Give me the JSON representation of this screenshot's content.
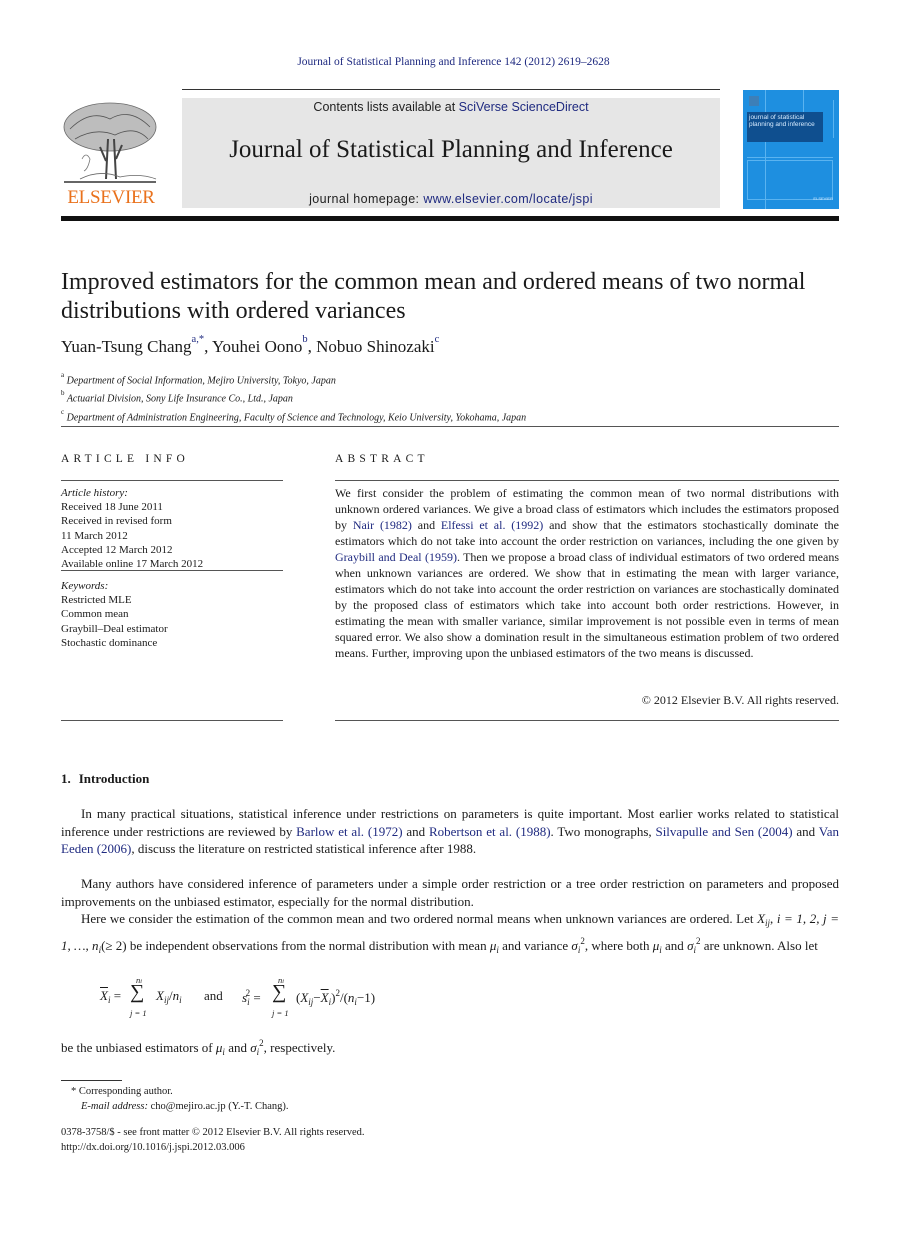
{
  "running_header": "Journal of Statistical Planning and Inference 142 (2012) 2619–2628",
  "masthead": {
    "publisher_logo_text": "ELSEVIER",
    "contents_prefix": "Contents lists available at ",
    "contents_link": "SciVerse ScienceDirect",
    "journal_title": "Journal of Statistical Planning and Inference",
    "homepage_prefix": "journal homepage: ",
    "homepage_link": "www.elsevier.com/locate/jspi",
    "cover_title": "journal of statistical planning and inference",
    "colors": {
      "publisher_orange": "#e9711c",
      "link_blue": "#1f2a80",
      "cover_blue": "#1e8fe0",
      "masthead_gray": "#e6e6e6"
    }
  },
  "article": {
    "title": "Improved estimators for the common mean and ordered means of two normal distributions with ordered variances",
    "authors": [
      {
        "name": "Yuan-Tsung Chang",
        "marks": "a,*",
        "separator": ", "
      },
      {
        "name": "Youhei Oono",
        "marks": "b",
        "separator": ", "
      },
      {
        "name": "Nobuo Shinozaki",
        "marks": "c",
        "separator": ""
      }
    ],
    "affiliations": [
      {
        "mark": "a",
        "text": "Department of Social Information, Mejiro University, Tokyo, Japan"
      },
      {
        "mark": "b",
        "text": "Actuarial Division, Sony Life Insurance Co., Ltd., Japan"
      },
      {
        "mark": "c",
        "text": "Department of Administration Engineering, Faculty of Science and Technology, Keio University, Yokohama, Japan"
      }
    ]
  },
  "article_info": {
    "heading": "ARTICLE INFO",
    "history_label": "Article history:",
    "history": [
      "Received 18 June 2011",
      "Received in revised form",
      "11 March 2012",
      "Accepted 12 March 2012",
      "Available online 17 March 2012"
    ],
    "keywords_label": "Keywords:",
    "keywords": [
      "Restricted MLE",
      "Common mean",
      "Graybill–Deal estimator",
      "Stochastic dominance"
    ]
  },
  "abstract": {
    "heading": "ABSTRACT",
    "t1": "We first consider the problem of estimating the common mean of two normal distributions with unknown ordered variances. We give a broad class of estimators which includes the estimators proposed by ",
    "ref1": "Nair (1982)",
    "t2": " and ",
    "ref2": "Elfessi et al. (1992)",
    "t3": " and show that the estimators stochastically dominate the estimators which do not take into account the order restriction on variances, including the one given by ",
    "ref3": "Graybill and Deal (1959)",
    "t4": ". Then we propose a broad class of individual estimators of two ordered means when unknown variances are ordered. We show that in estimating the mean with larger variance, estimators which do not take into account the order restriction on variances are stochastically dominated by the proposed class of estimators which take into account both order restrictions. However, in estimating the mean with smaller variance, similar improvement is not possible even in terms of mean squared error. We also show a domination result in the simultaneous estimation problem of two ordered means. Further, improving upon the unbiased estimators of the two means is discussed.",
    "copyright": "© 2012 Elsevier B.V. All rights reserved."
  },
  "introduction": {
    "number": "1.",
    "heading": "Introduction",
    "p1_t1": "In many practical situations, statistical inference under restrictions on parameters is quite important. Most earlier works related to statistical inference under restrictions are reviewed by ",
    "p1_ref1": "Barlow et al. (1972)",
    "p1_t2": " and ",
    "p1_ref2": "Robertson et al. (1988)",
    "p1_t3": ". Two monographs, ",
    "p1_ref3": "Silvapulle and Sen (2004)",
    "p1_t4": " and ",
    "p1_ref4": "Van Eeden (2006)",
    "p1_t5": ", discuss the literature on restricted statistical inference after 1988.",
    "p2": "Many authors have considered inference of parameters under a simple order restriction or a tree order restriction on parameters and proposed improvements on the unbiased estimator, especially for the normal distribution.",
    "p3_t1": "Here we consider the estimation of the common mean and two ordered normal means when unknown variances are ordered. Let ",
    "p3_x": "X",
    "p3_xsub": "ij",
    "p3_t2": ", ",
    "p3_index": "i = 1, 2, j = 1, …, n",
    "p3_nsub": "i",
    "p3_t3": "(≥ 2) be independent observations from the normal distribution with mean ",
    "p3_mu": "μ",
    "p3_t4": " and variance ",
    "p3_sigma": "σ",
    "p3_t5": ", where both ",
    "p3_t6": " and ",
    "p3_t7": " are unknown. Also let",
    "eq_and": "and",
    "p4_t1": "be the unbiased estimators of ",
    "p4_t2": " and ",
    "p4_t3": ", respectively."
  },
  "footnotes": {
    "corresponding": "* Corresponding author.",
    "email_label": "E-mail address: ",
    "email": "cho@mejiro.ac.jp (Y.-T. Chang).",
    "front_matter": "0378-3758/$ - see front matter © 2012 Elsevier B.V. All rights reserved.",
    "doi": "http://dx.doi.org/10.1016/j.jspi.2012.03.006"
  }
}
